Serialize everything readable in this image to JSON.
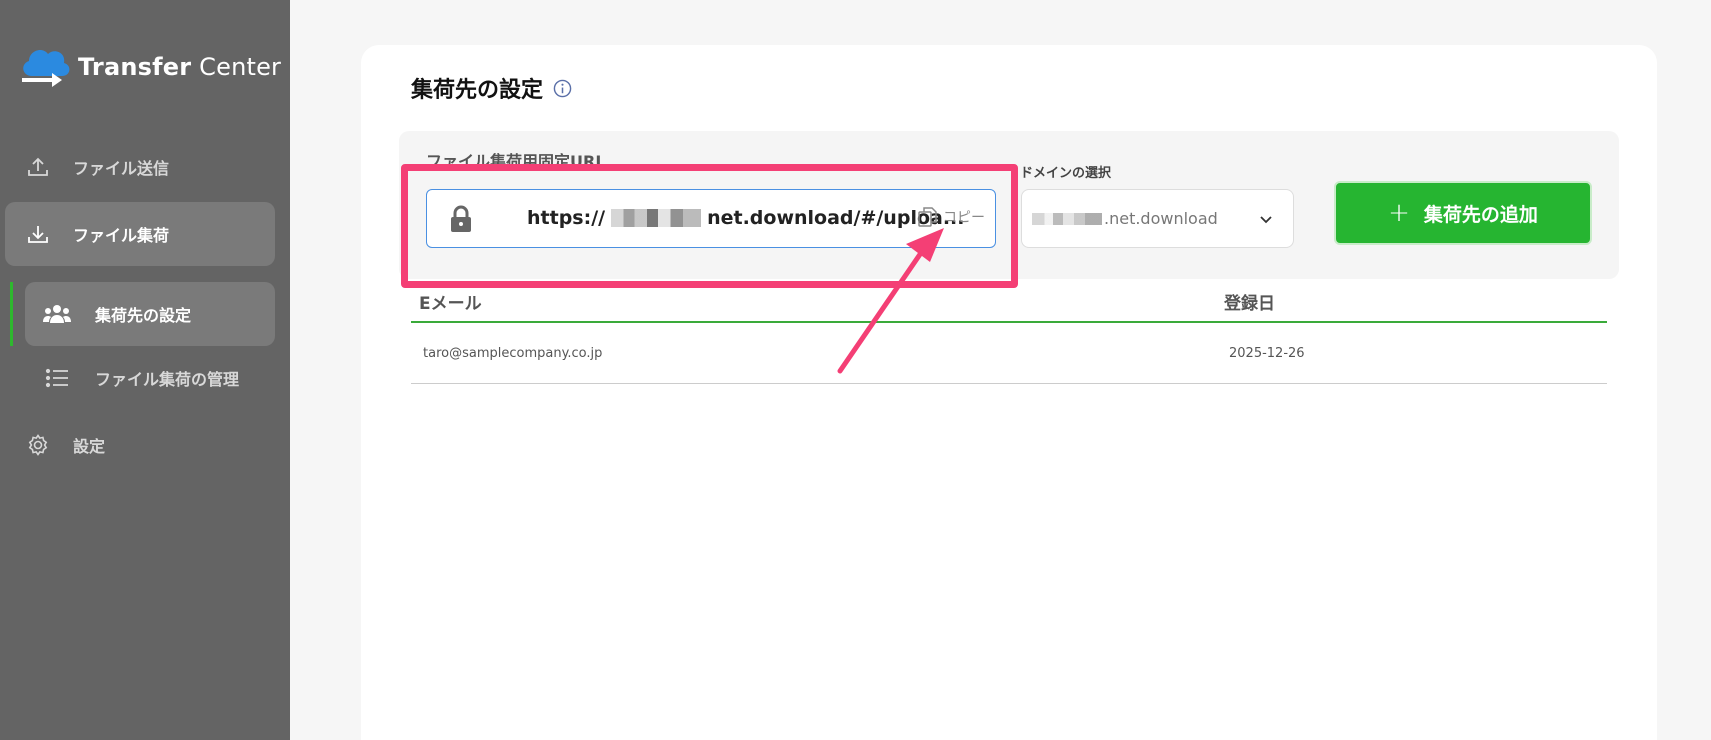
{
  "app": {
    "title_bold": "Transfer",
    "title_regular": "Center"
  },
  "sidebar": {
    "items": [
      {
        "label": "ファイル送信",
        "icon": "upload-icon"
      },
      {
        "label": "ファイル集荷",
        "icon": "download-icon"
      },
      {
        "label": "集荷先の設定",
        "icon": "users-icon"
      },
      {
        "label": "ファイル集荷の管理",
        "icon": "list-icon"
      },
      {
        "label": "設定",
        "icon": "gear-icon"
      }
    ]
  },
  "main": {
    "title": "集荷先の設定",
    "url_label": "ファイル集荷用固定URL",
    "url_prefix": "https://",
    "url_suffix": "net.download/#/uploa...",
    "copy_label": "コピー",
    "domain_label": "ドメインの選択",
    "domain_value": ".net.download",
    "add_button": "集荷先の追加",
    "add_icon": "+",
    "table": {
      "headers": [
        "Eメール",
        "登録日"
      ],
      "rows": [
        {
          "email": "taro@samplecompany.co.jp",
          "date": "2025-12-26"
        }
      ]
    }
  },
  "colors": {
    "accent_green": "#26b531",
    "highlight": "#f43f75",
    "sidebar_bg": "#646464"
  }
}
